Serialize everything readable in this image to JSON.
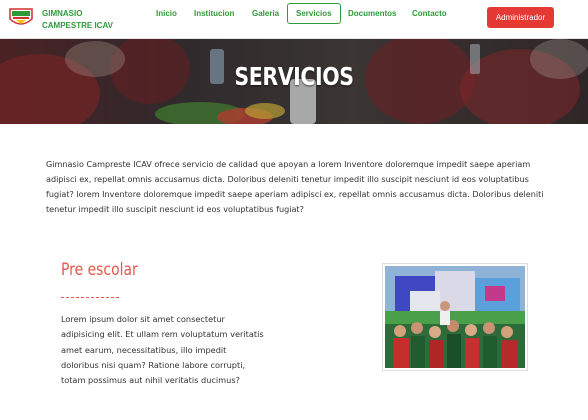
{
  "brand": {
    "line1": "GIMNASIO",
    "line2": "CAMPESTRE ICAV",
    "logo_icon": "school-crest-icon"
  },
  "nav": {
    "items": [
      {
        "label": "Inicio",
        "active": false
      },
      {
        "label": "Institucion",
        "active": false
      },
      {
        "label": "Galeria",
        "active": false
      },
      {
        "label": "Servicios",
        "active": true
      },
      {
        "label": "Documentos",
        "active": false
      },
      {
        "label": "Contacto",
        "active": false
      }
    ],
    "admin_label": "Administrador"
  },
  "hero": {
    "title": "SERVICIOS"
  },
  "intro": {
    "text": "Gimnasio Campreste ICAV ofrece servicio de calidad que apoyan a lorem Inventore doloremque impedit saepe aperiam adipisci ex, repellat omnis accusamus dicta. Doloribus deleniti tenetur impedit illo suscipit nesciunt id eos voluptatibus fugiat? lorem Inventore doloremque impedit saepe aperiam adipisci ex, repellat omnis accusamus dicta. Doloribus deleniti tenetur impedit illo suscipit nesciunt id eos voluptatibus fugiat?"
  },
  "service": {
    "title": "Pre escolar",
    "text": "Lorem ipsum dolor sit amet consectetur adipisicing elit. Et ullam rem voluptatum veritatis amet earum, necessitatibus, illo impedit doloribus nisi quam? Ratione labore corrupti, totam possimus aut nihil veritatis ducimus?"
  },
  "colors": {
    "brand_green": "#2f9a3a",
    "accent_red": "#e53935",
    "title_red": "#e2574c"
  }
}
